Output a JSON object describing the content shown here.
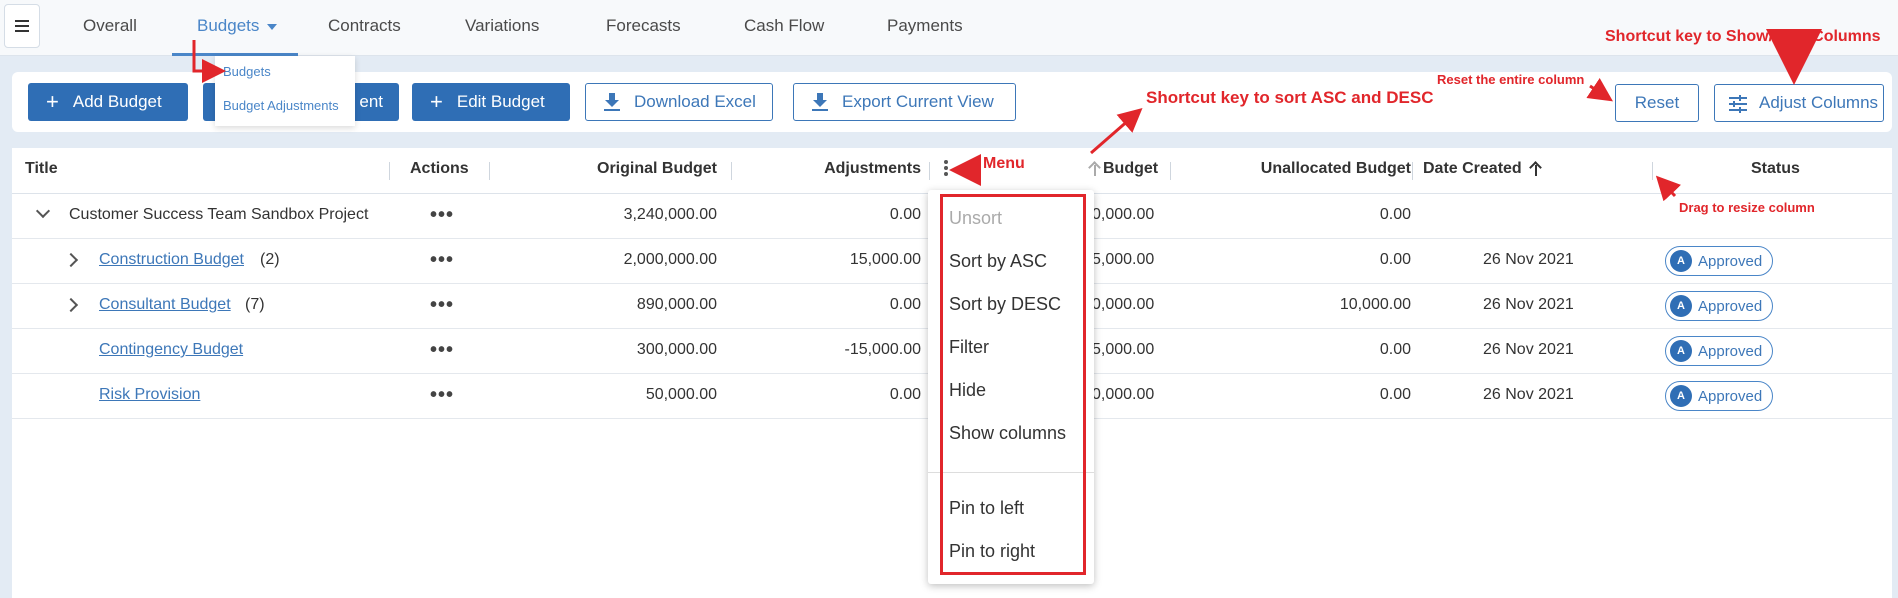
{
  "nav": {
    "tabs": [
      {
        "label": "Overall"
      },
      {
        "label": "Budgets"
      },
      {
        "label": "Contracts"
      },
      {
        "label": "Variations"
      },
      {
        "label": "Forecasts"
      },
      {
        "label": "Cash Flow"
      },
      {
        "label": "Payments"
      }
    ],
    "dropdown": {
      "items": [
        "Budgets",
        "Budget Adjustments"
      ]
    }
  },
  "toolbar": {
    "add_budget": "Add Budget",
    "adjustment_hidden_part": "ent",
    "edit_budget": "Edit Budget",
    "download_excel": "Download Excel",
    "export_view": "Export Current View",
    "reset": "Reset",
    "adjust_columns": "Adjust Columns"
  },
  "table": {
    "columns": [
      "Title",
      "Actions",
      "Original Budget",
      "Adjustments",
      "Budget",
      "Unallocated Budget",
      "Date Created",
      "Status"
    ],
    "rows": [
      {
        "title": "Customer Success Team Sandbox Project",
        "count": "",
        "original": "3,240,000.00",
        "adjustments": "0.00",
        "budget": "0,000.00",
        "unallocated": "0.00",
        "date": "",
        "status": ""
      },
      {
        "title": "Construction Budget",
        "count": "(2)",
        "original": "2,000,000.00",
        "adjustments": "15,000.00",
        "budget": "5,000.00",
        "unallocated": "0.00",
        "date": "26 Nov 2021",
        "status": "Approved"
      },
      {
        "title": "Consultant Budget",
        "count": "(7)",
        "original": "890,000.00",
        "adjustments": "0.00",
        "budget": "0,000.00",
        "unallocated": "10,000.00",
        "date": "26 Nov 2021",
        "status": "Approved"
      },
      {
        "title": "Contingency Budget",
        "count": "",
        "original": "300,000.00",
        "adjustments": "-15,000.00",
        "budget": "5,000.00",
        "unallocated": "0.00",
        "date": "26 Nov 2021",
        "status": "Approved"
      },
      {
        "title": "Risk Provision",
        "count": "",
        "original": "50,000.00",
        "adjustments": "0.00",
        "budget": "0,000.00",
        "unallocated": "0.00",
        "date": "26 Nov 2021",
        "status": "Approved"
      }
    ],
    "status_avatar": "A"
  },
  "column_menu": {
    "items": [
      "Unsort",
      "Sort by ASC",
      "Sort by DESC",
      "Filter",
      "Hide",
      "Show columns"
    ],
    "pin_items": [
      "Pin to left",
      "Pin to right"
    ]
  },
  "annotations": {
    "menu": "Menu",
    "sort_shortcut": "Shortcut key to sort ASC and DESC",
    "reset_column": "Reset the entire column",
    "show_hide": "Shortcut key to Show/Hide Columns",
    "resize": "Drag to resize column"
  },
  "colors": {
    "accent": "#2f6eb5",
    "link": "#3d77b8",
    "annotation": "#e1262b"
  }
}
